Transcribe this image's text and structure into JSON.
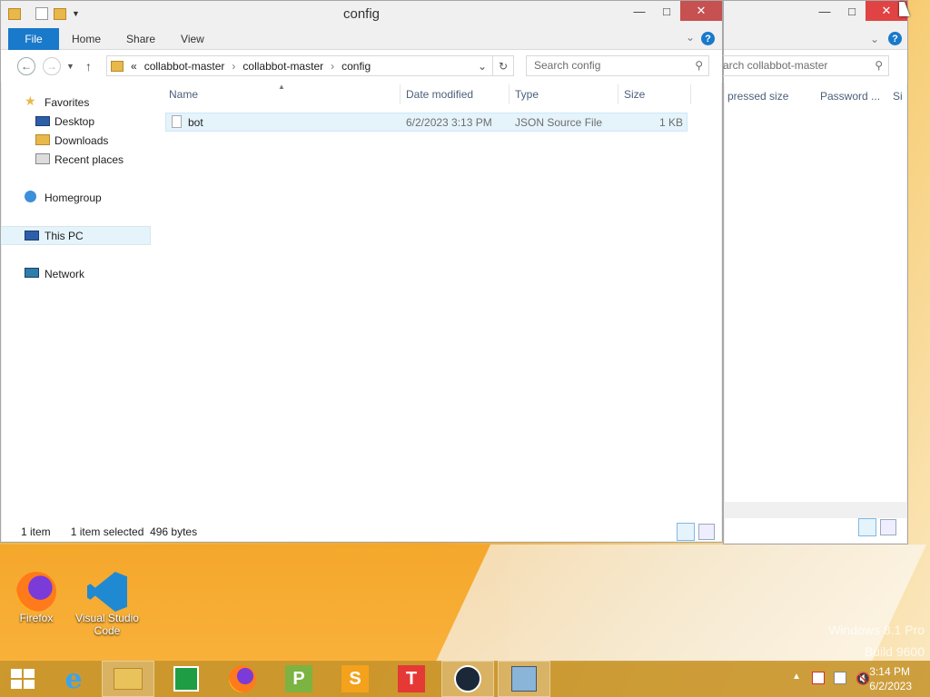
{
  "desktop": {
    "watermark_line1": "Windows 8.1 Pro",
    "watermark_line2": "Build 9600",
    "icons": [
      {
        "label": "Firefox",
        "icon": "firefox-icon"
      },
      {
        "label": "Visual Studio Code",
        "icon": "vscode-icon"
      }
    ]
  },
  "back_window": {
    "search_placeholder": "arch collabbot-master",
    "columns": [
      "pressed size",
      "Password ...",
      "Si"
    ]
  },
  "window": {
    "title": "config",
    "ribbon_tabs": [
      "File",
      "Home",
      "Share",
      "View"
    ],
    "breadcrumb": [
      "«",
      "collabbot-master",
      "collabbot-master",
      "config"
    ],
    "search_placeholder": "Search config",
    "nav": {
      "favorites": "Favorites",
      "desktop": "Desktop",
      "downloads": "Downloads",
      "recent": "Recent places",
      "homegroup": "Homegroup",
      "thispc": "This PC",
      "network": "Network"
    },
    "columns": {
      "name": "Name",
      "date": "Date modified",
      "type": "Type",
      "size": "Size"
    },
    "files": [
      {
        "name": "bot",
        "date": "6/2/2023 3:13 PM",
        "type": "JSON Source File",
        "size": "1 KB"
      }
    ],
    "status": {
      "count": "1 item",
      "selected": "1 item selected  496 bytes"
    }
  },
  "taskbar": {
    "apps": [
      "start",
      "internet-explorer",
      "file-explorer",
      "store",
      "firefox",
      "project",
      "sublime",
      "t-app",
      "steam",
      "network-tool"
    ],
    "time": "3:14 PM",
    "date": "6/2/2023"
  },
  "colors": {
    "accent": "#1979ca",
    "selection": "#cce8ff",
    "close": "#c75050"
  }
}
